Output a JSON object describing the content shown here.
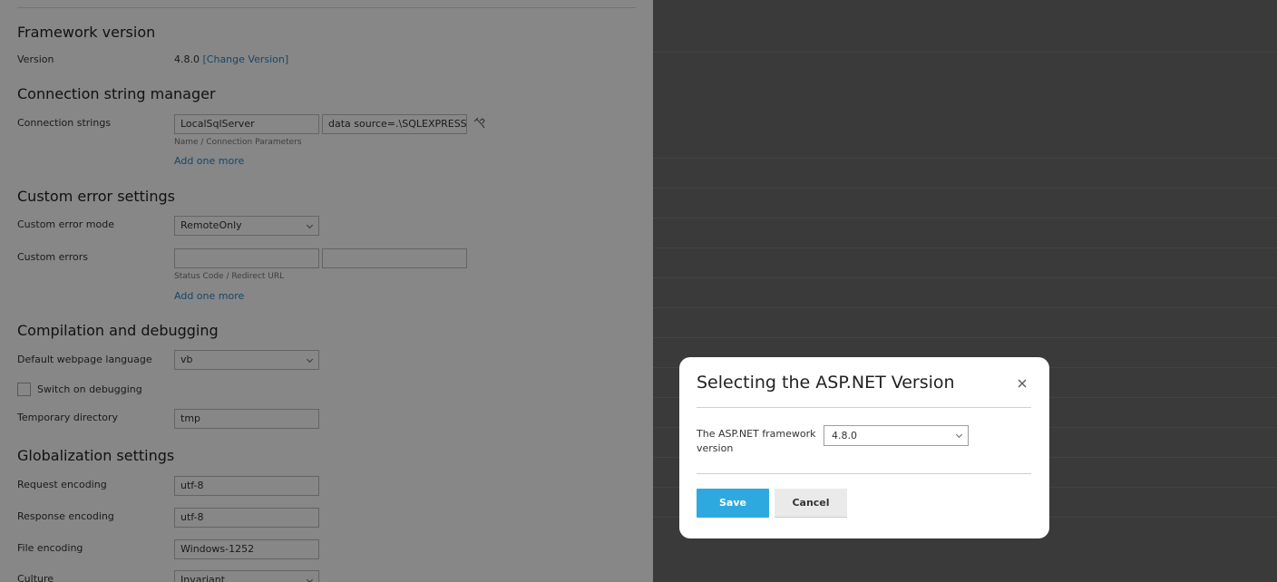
{
  "sections": {
    "framework": {
      "title": "Framework version",
      "version_label": "Version",
      "version_value": "4.8.0",
      "change_link": "[Change Version]"
    },
    "connection": {
      "title": "Connection string manager",
      "label": "Connection strings",
      "name_value": "LocalSqlServer",
      "params_value": "data source=.\\SQLEXPRESS;I",
      "hint": "Name / Connection Parameters",
      "add_more": "Add one more"
    },
    "custom_errors": {
      "title": "Custom error settings",
      "mode_label": "Custom error mode",
      "mode_value": "RemoteOnly",
      "errors_label": "Custom errors",
      "hint": "Status Code / Redirect URL",
      "add_more": "Add one more"
    },
    "compilation": {
      "title": "Compilation and debugging",
      "language_label": "Default webpage language",
      "language_value": "vb",
      "debug_label": "Switch on debugging",
      "tmp_label": "Temporary directory",
      "tmp_value": "tmp"
    },
    "globalization": {
      "title": "Globalization settings",
      "request_label": "Request encoding",
      "request_value": "utf-8",
      "response_label": "Response encoding",
      "response_value": "utf-8",
      "file_label": "File encoding",
      "file_value": "Windows-1252",
      "culture_label": "Culture",
      "culture_value": "Invariant"
    }
  },
  "modal": {
    "title": "Selecting the ASP.NET Version",
    "field_label": "The ASP.NET framework version",
    "select_value": "4.8.0",
    "save_label": "Save",
    "cancel_label": "Cancel"
  },
  "colors": {
    "accent": "#2ea9e0",
    "link": "#2a87c9",
    "backdrop": "#3a3a3a"
  }
}
